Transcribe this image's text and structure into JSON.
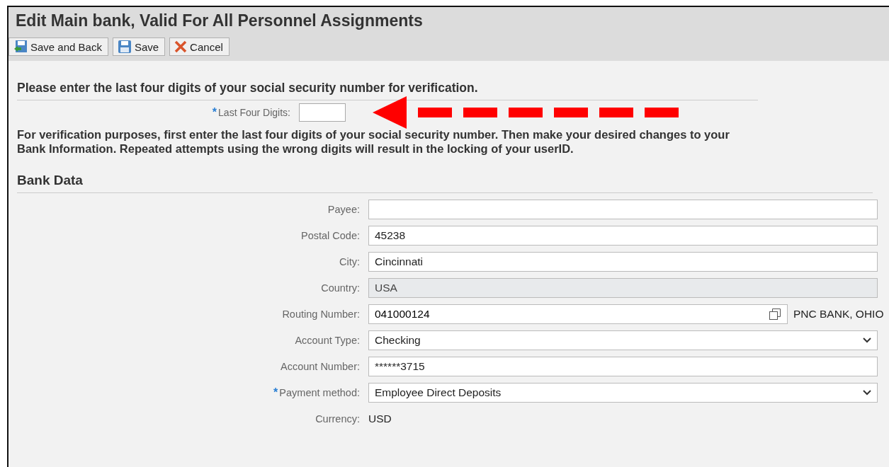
{
  "title": "Edit Main bank, Valid For All Personnel Assignments",
  "toolbar": [
    {
      "kind": "save-back",
      "label": "Save and Back"
    },
    {
      "kind": "save",
      "label": "Save"
    },
    {
      "kind": "cancel",
      "label": "Cancel"
    }
  ],
  "verification": {
    "heading": "Please enter the last four digits of your social security number for verification.",
    "field": {
      "label": "Last Four Digits:",
      "required": true,
      "required_mark": "*"
    },
    "note": "For verification purposes, first enter the last four digits of your social security number. Then make your desired changes to your Bank Information. Repeated attempts using the wrong digits will result in the locking of your userID."
  },
  "bank_data": {
    "heading": "Bank Data",
    "fields": [
      {
        "label": "Payee:",
        "kind": "input",
        "required": false
      },
      {
        "label": "Postal Code:",
        "kind": "input",
        "required": false,
        "value": "45238"
      },
      {
        "label": "City:",
        "kind": "input",
        "required": false,
        "value": "Cincinnati"
      },
      {
        "label": "Country:",
        "kind": "readonly",
        "required": false,
        "value": "USA"
      },
      {
        "label": "Routing Number:",
        "kind": "valuehelp",
        "required": false,
        "value": "041000124",
        "description": "PNC BANK, OHIO"
      },
      {
        "label": "Account Type:",
        "kind": "select",
        "required": false,
        "value": "Checking"
      },
      {
        "label": "Account Number:",
        "kind": "input",
        "required": false,
        "value": "******3715"
      },
      {
        "label": "Payment method:",
        "kind": "select",
        "required": true,
        "required_mark": "*",
        "value": "Employee Direct Deposits"
      },
      {
        "label": "Currency:",
        "kind": "text",
        "required": false,
        "value": "USD"
      }
    ]
  }
}
